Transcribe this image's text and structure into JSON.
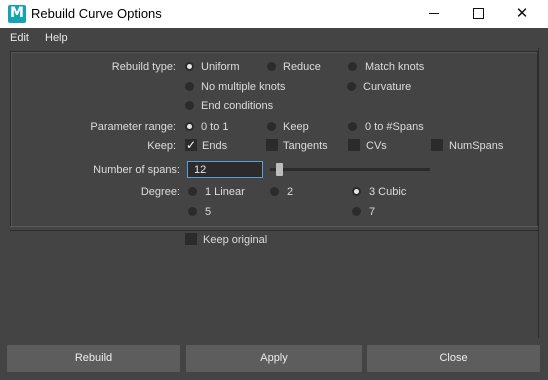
{
  "window": {
    "title": "Rebuild Curve Options",
    "app_icon_letter": "M",
    "app_icon_color": "#16a3b4",
    "close_glyph": "✕"
  },
  "menu": {
    "items": [
      "Edit",
      "Help"
    ]
  },
  "rebuild_type": {
    "label": "Rebuild type:",
    "options": [
      "Uniform",
      "Reduce",
      "Match knots",
      "No multiple knots",
      "Curvature",
      "End conditions"
    ],
    "selected": "Uniform"
  },
  "parameter_range": {
    "label": "Parameter range:",
    "options": [
      "0 to 1",
      "Keep",
      "0 to #Spans"
    ],
    "selected": "0 to 1"
  },
  "keep": {
    "label": "Keep:",
    "options": [
      "Ends",
      "Tangents",
      "CVs",
      "NumSpans"
    ],
    "checked": [
      "Ends"
    ],
    "check_glyph": "✓"
  },
  "number_of_spans": {
    "label": "Number of spans:",
    "value": "12",
    "slider_level": 0.06
  },
  "degree": {
    "label": "Degree:",
    "options": [
      "1 Linear",
      "2",
      "3 Cubic",
      "5",
      "7"
    ],
    "selected": "3 Cubic"
  },
  "keep_original": {
    "label": "Keep original",
    "checked": false
  },
  "buttons": {
    "rebuild": "Rebuild",
    "apply": "Apply",
    "close": "Close"
  },
  "colors": {
    "background": "#444444",
    "field": "#2b2b2b",
    "button": "#5d5d5d",
    "focus": "#5aa0d6"
  }
}
